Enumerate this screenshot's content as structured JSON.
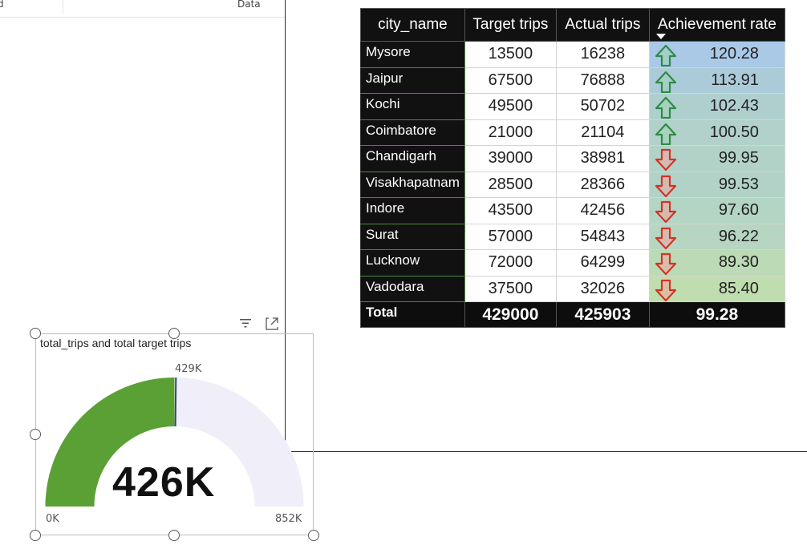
{
  "top_fragment": {
    "left_text": "d",
    "right_text": "Data"
  },
  "matrix": {
    "headers": [
      "city_name",
      "Target trips",
      "Actual trips",
      "Achievement rate"
    ],
    "rows": [
      {
        "city": "Mysore",
        "target": "13500",
        "actual": "16238",
        "rate": "120.28",
        "trend": "up",
        "bg": "#a9c9e6"
      },
      {
        "city": "Jaipur",
        "target": "67500",
        "actual": "76888",
        "rate": "113.91",
        "trend": "up",
        "bg": "#accbd9"
      },
      {
        "city": "Kochi",
        "target": "49500",
        "actual": "50702",
        "rate": "102.43",
        "trend": "up",
        "bg": "#afcfcd"
      },
      {
        "city": "Coimbatore",
        "target": "21000",
        "actual": "21104",
        "rate": "100.50",
        "trend": "up",
        "bg": "#b1d1ca"
      },
      {
        "city": "Chandigarh",
        "target": "39000",
        "actual": "38981",
        "rate": "99.95",
        "trend": "down",
        "bg": "#b2d2c8"
      },
      {
        "city": "Visakhapatnam",
        "target": "28500",
        "actual": "28366",
        "rate": "99.53",
        "trend": "down",
        "bg": "#b2d2c7"
      },
      {
        "city": "Indore",
        "target": "43500",
        "actual": "42456",
        "rate": "97.60",
        "trend": "down",
        "bg": "#b4d4c4"
      },
      {
        "city": "Surat",
        "target": "57000",
        "actual": "54843",
        "rate": "96.22",
        "trend": "down",
        "bg": "#b6d6c1"
      },
      {
        "city": "Lucknow",
        "target": "72000",
        "actual": "64299",
        "rate": "89.30",
        "trend": "down",
        "bg": "#bbdab5"
      },
      {
        "city": "Vadodara",
        "target": "37500",
        "actual": "32026",
        "rate": "85.40",
        "trend": "down",
        "bg": "#c0ddaf"
      }
    ],
    "total": {
      "label": "Total",
      "target": "429000",
      "actual": "425903",
      "rate": "99.28"
    },
    "colors": {
      "up_arrow": "#2e8b45",
      "down_arrow": "#d93025",
      "header_bg": "#111111"
    }
  },
  "gauge": {
    "title": "total_trips and total target trips",
    "value_label": "426K",
    "target_label": "429K",
    "min_label": "0K",
    "max_label": "852K",
    "value": 425903,
    "target": 429000,
    "min": 0,
    "max": 852000,
    "colors": {
      "fill": "#5aa035",
      "track": "#efeef9",
      "target_line": "#2e4a6b"
    }
  }
}
